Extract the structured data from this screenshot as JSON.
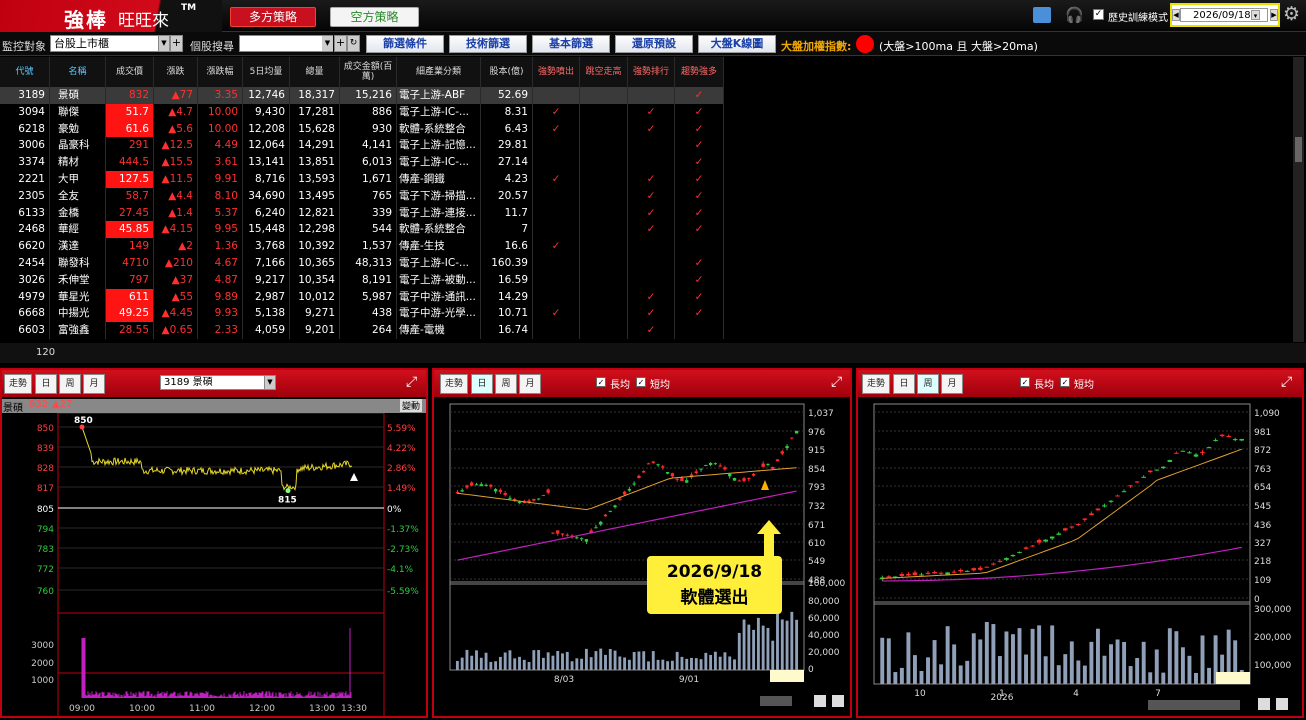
{
  "header": {
    "logo_main": "強棒",
    "logo_sub": "旺旺來",
    "logo_tm": "TM",
    "tab_long": "多方策略",
    "tab_short": "空方策略",
    "history_mode_label": "歷史訓練模式",
    "date": "2026/09/18"
  },
  "toolbar": {
    "monitor_label": "監控對象",
    "monitor_value": "台股上市櫃",
    "stock_search_label": "個股搜尋",
    "stock_search_value": "",
    "buttons": [
      "篩選條件",
      "技術篩選",
      "基本篩選",
      "還原預設",
      "大盤K線圖"
    ],
    "index_label": "大盤加權指數:",
    "index_status_text": "(大盤>100ma 且 大盤>20ma)"
  },
  "table": {
    "columns": [
      "代號",
      "名稱",
      "成交價",
      "漲跌",
      "漲跌幅",
      "5日均量",
      "總量",
      "成交金額(百萬)",
      "細產業分類",
      "股本(億)",
      "強勢噴出",
      "跳空走高",
      "強勢排行",
      "趨勢強多"
    ],
    "rows": [
      {
        "code": "3189",
        "name": "景碩",
        "price": "832",
        "chg": "▲77",
        "pct": "3.35",
        "avg5": "12,746",
        "vol": "18,317",
        "amt": "15,216",
        "ind": "電子上游-ABF",
        "cap": "52.69",
        "c1": "",
        "c2": "",
        "c3": "",
        "c4": "✓",
        "limit": false
      },
      {
        "code": "3094",
        "name": "聯傑",
        "price": "51.7",
        "chg": "▲4.7",
        "pct": "10.00",
        "avg5": "9,430",
        "vol": "17,281",
        "amt": "886",
        "ind": "電子上游-IC-...",
        "cap": "8.31",
        "c1": "✓",
        "c2": "",
        "c3": "✓",
        "c4": "✓",
        "limit": true
      },
      {
        "code": "6218",
        "name": "豪勉",
        "price": "61.6",
        "chg": "▲5.6",
        "pct": "10.00",
        "avg5": "12,208",
        "vol": "15,628",
        "amt": "930",
        "ind": "軟體-系統整合",
        "cap": "6.43",
        "c1": "✓",
        "c2": "",
        "c3": "✓",
        "c4": "✓",
        "limit": true
      },
      {
        "code": "3006",
        "name": "晶豪科",
        "price": "291",
        "chg": "▲12.5",
        "pct": "4.49",
        "avg5": "12,064",
        "vol": "14,291",
        "amt": "4,141",
        "ind": "電子上游-記憶...",
        "cap": "29.81",
        "c1": "",
        "c2": "",
        "c3": "",
        "c4": "✓",
        "limit": false
      },
      {
        "code": "3374",
        "name": "精材",
        "price": "444.5",
        "chg": "▲15.5",
        "pct": "3.61",
        "avg5": "13,141",
        "vol": "13,851",
        "amt": "6,013",
        "ind": "電子上游-IC-...",
        "cap": "27.14",
        "c1": "",
        "c2": "",
        "c3": "",
        "c4": "✓",
        "limit": false
      },
      {
        "code": "2221",
        "name": "大甲",
        "price": "127.5",
        "chg": "▲11.5",
        "pct": "9.91",
        "avg5": "8,716",
        "vol": "13,593",
        "amt": "1,671",
        "ind": "傳產-鋼鐵",
        "cap": "4.23",
        "c1": "✓",
        "c2": "",
        "c3": "✓",
        "c4": "✓",
        "limit": true
      },
      {
        "code": "2305",
        "name": "全友",
        "price": "58.7",
        "chg": "▲4.4",
        "pct": "8.10",
        "avg5": "34,690",
        "vol": "13,495",
        "amt": "765",
        "ind": "電子下游-掃描...",
        "cap": "20.57",
        "c1": "",
        "c2": "",
        "c3": "✓",
        "c4": "✓",
        "limit": false
      },
      {
        "code": "6133",
        "name": "金橋",
        "price": "27.45",
        "chg": "▲1.4",
        "pct": "5.37",
        "avg5": "6,240",
        "vol": "12,821",
        "amt": "339",
        "ind": "電子上游-連接...",
        "cap": "11.7",
        "c1": "",
        "c2": "",
        "c3": "✓",
        "c4": "✓",
        "limit": false
      },
      {
        "code": "2468",
        "name": "華經",
        "price": "45.85",
        "chg": "▲4.15",
        "pct": "9.95",
        "avg5": "15,448",
        "vol": "12,298",
        "amt": "544",
        "ind": "軟體-系統整合",
        "cap": "7",
        "c1": "",
        "c2": "",
        "c3": "✓",
        "c4": "✓",
        "limit": true
      },
      {
        "code": "6620",
        "name": "漢達",
        "price": "149",
        "chg": "▲2",
        "pct": "1.36",
        "avg5": "3,768",
        "vol": "10,392",
        "amt": "1,537",
        "ind": "傳產-生技",
        "cap": "16.6",
        "c1": "✓",
        "c2": "",
        "c3": "",
        "c4": "",
        "limit": false
      },
      {
        "code": "2454",
        "name": "聯發科",
        "price": "4710",
        "chg": "▲210",
        "pct": "4.67",
        "avg5": "7,166",
        "vol": "10,365",
        "amt": "48,313",
        "ind": "電子上游-IC-...",
        "cap": "160.39",
        "c1": "",
        "c2": "",
        "c3": "",
        "c4": "✓",
        "limit": false
      },
      {
        "code": "3026",
        "name": "禾伸堂",
        "price": "797",
        "chg": "▲37",
        "pct": "4.87",
        "avg5": "9,217",
        "vol": "10,354",
        "amt": "8,191",
        "ind": "電子上游-被動...",
        "cap": "16.59",
        "c1": "",
        "c2": "",
        "c3": "",
        "c4": "✓",
        "limit": false
      },
      {
        "code": "4979",
        "name": "華星光",
        "price": "611",
        "chg": "▲55",
        "pct": "9.89",
        "avg5": "2,987",
        "vol": "10,012",
        "amt": "5,987",
        "ind": "電子中游-通訊...",
        "cap": "14.29",
        "c1": "",
        "c2": "",
        "c3": "✓",
        "c4": "✓",
        "limit": true
      },
      {
        "code": "6668",
        "name": "中揚光",
        "price": "49.25",
        "chg": "▲4.45",
        "pct": "9.93",
        "avg5": "5,138",
        "vol": "9,271",
        "amt": "438",
        "ind": "電子中游-光學...",
        "cap": "10.71",
        "c1": "✓",
        "c2": "",
        "c3": "✓",
        "c4": "✓",
        "limit": true
      },
      {
        "code": "6603",
        "name": "富強鑫",
        "price": "28.55",
        "chg": "▲0.65",
        "pct": "2.33",
        "avg5": "4,059",
        "vol": "9,201",
        "amt": "264",
        "ind": "傳產-電機",
        "cap": "16.74",
        "c1": "",
        "c2": "",
        "c3": "✓",
        "c4": "",
        "limit": false
      }
    ],
    "row_count": "120"
  },
  "panel_intraday": {
    "tabs": [
      "走勢",
      "日",
      "周",
      "月"
    ],
    "stock_select": "3189 景碩",
    "title_name": "景碩",
    "title_price": "832",
    "title_chg": "▲27",
    "variation_label": "變動",
    "price_ticks": [
      "850",
      "839",
      "828",
      "817",
      "805",
      "794",
      "783",
      "772",
      "760"
    ],
    "pct_ticks": [
      "5.59%",
      "4.22%",
      "2.86%",
      "1.49%",
      "0%",
      "-1.37%",
      "-2.73%",
      "-4.1%",
      "-5.59%"
    ],
    "high_label": "850",
    "low_label": "815",
    "vol_ticks": [
      "3000",
      "2000",
      "1000"
    ],
    "time_ticks": [
      "09:00",
      "10:00",
      "11:00",
      "12:00",
      "13:00",
      "13:30"
    ]
  },
  "panel_daily": {
    "tabs": [
      "走勢",
      "日",
      "周",
      "月"
    ],
    "ma_long_label": "長均",
    "ma_short_label": "短均",
    "price_ticks": [
      "1,037",
      "976",
      "915",
      "854",
      "793",
      "732",
      "671",
      "610",
      "549",
      "488"
    ],
    "vol_ticks": [
      "100,000",
      "80,000",
      "60,000",
      "40,000",
      "20,000",
      "0"
    ],
    "x_ticks": [
      "8/03",
      "9/01"
    ]
  },
  "panel_weekly": {
    "tabs": [
      "走勢",
      "日",
      "周",
      "月"
    ],
    "ma_long_label": "長均",
    "ma_short_label": "短均",
    "price_ticks": [
      "1,090",
      "981",
      "872",
      "763",
      "654",
      "545",
      "436",
      "327",
      "218",
      "109",
      "0"
    ],
    "vol_ticks": [
      "300,000",
      "200,000",
      "100,000"
    ],
    "x_ticks": [
      "10",
      "1",
      "4",
      "7"
    ],
    "x_year": "2026"
  },
  "callout": {
    "line1": "2026/9/18",
    "line2": "軟體選出"
  },
  "colors": {
    "up": "#ff2a2a",
    "down": "#2ecc40",
    "limit_bg": "#ff1414",
    "accent_red": "#c00010",
    "highlight": "#ffef3a"
  }
}
